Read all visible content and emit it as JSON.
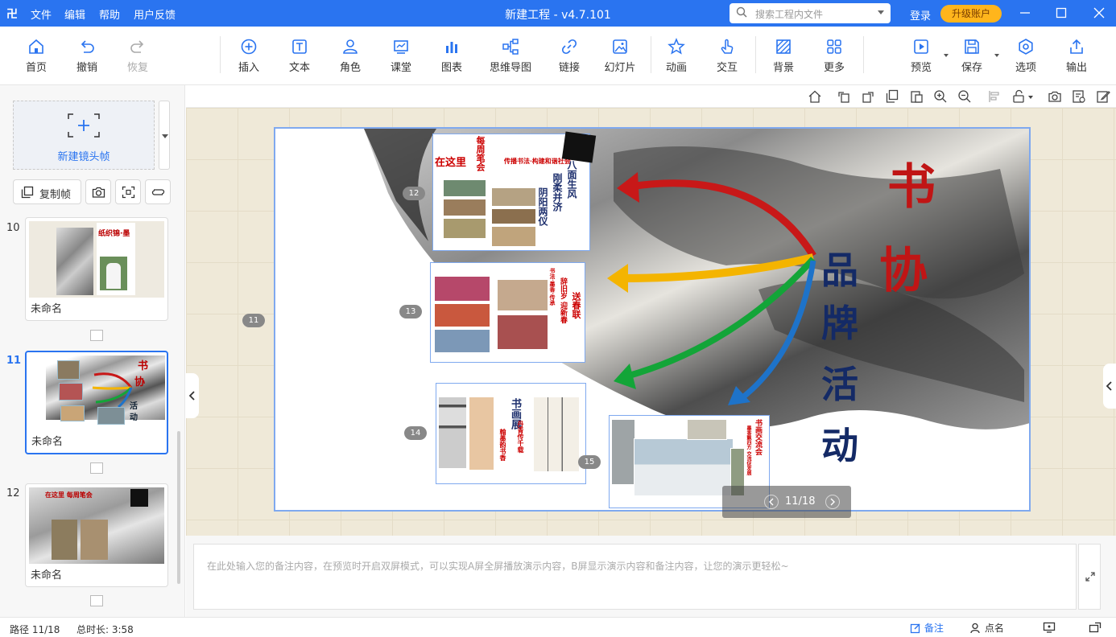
{
  "app": {
    "logo": "卍",
    "title": "新建工程 - v4.7.101",
    "menu": [
      "文件",
      "编辑",
      "帮助",
      "用户反馈"
    ],
    "search_placeholder": "搜索工程内文件",
    "login": "登录",
    "upgrade": "升级账户"
  },
  "toolbar": {
    "home": "首页",
    "undo": "撤销",
    "redo": "恢复",
    "insert": "插入",
    "text": "文本",
    "role": "角色",
    "classroom": "课堂",
    "chart": "图表",
    "mindmap": "思维导图",
    "link": "链接",
    "slideshow": "幻灯片",
    "animation": "动画",
    "interaction": "交互",
    "background": "背景",
    "more": "更多",
    "preview": "预览",
    "save": "保存",
    "options": "选项",
    "export": "输出"
  },
  "sidebar": {
    "new_frame": "新建镜头帧",
    "copy_frame": "复制帧",
    "thumbs": [
      {
        "num": "10",
        "name": "未命名"
      },
      {
        "num": "11",
        "name": "未命名"
      },
      {
        "num": "12",
        "name": "未命名"
      }
    ],
    "thumb10_caption": "纸织锦·墨",
    "thumb11_text": [
      "书",
      "协",
      "活",
      "动"
    ],
    "thumb12_title": "在这里 每周笔会"
  },
  "slide": {
    "frame_badges": [
      "11",
      "12",
      "13",
      "14",
      "15"
    ],
    "title_red": [
      "书",
      "协"
    ],
    "title_blue": [
      "品",
      "牌",
      "活",
      "动"
    ],
    "frame12_text": {
      "left": "在这里",
      "top": "每周笔会",
      "header": "传播书法·构建和谐社会",
      "poem": [
        "八面生风",
        "刚柔并济",
        "阴阳两仪"
      ]
    },
    "frame13_text": {
      "v1": "送春联",
      "v2": "辞旧岁 迎新春",
      "v3": "书法·墨香·传承"
    },
    "frame14_text": {
      "title": "书画展",
      "sub1": "丹青传千载",
      "sub2": "翰墨韵书香"
    },
    "frame15_text": {
      "title": "书画交流会",
      "sub": "墨香飘四方 交流促发展"
    },
    "arrow_colors": [
      "#c81818",
      "#f4b400",
      "#13a538",
      "#1e73c9"
    ]
  },
  "pager": {
    "text": "11/18"
  },
  "notes": {
    "placeholder": "在此处输入您的备注内容，在预览时开启双屏模式，可以实现A屏全屏播放演示内容，B屏显示演示内容和备注内容，让您的演示更轻松~"
  },
  "status": {
    "path": "路径 11/18",
    "duration": "总时长: 3:58",
    "notes_btn": "备注",
    "rollcall_btn": "点名"
  },
  "colors": {
    "accent": "#2a74f0",
    "upgrade": "#ffb51c"
  }
}
